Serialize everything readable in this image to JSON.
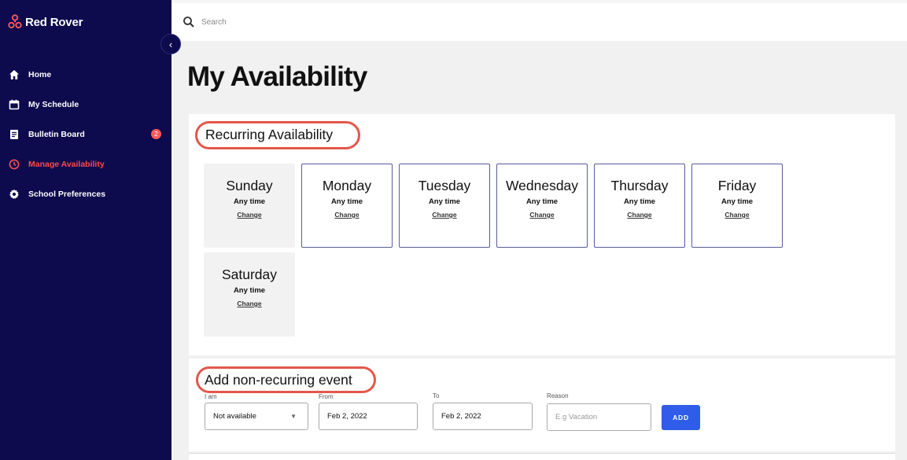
{
  "app": {
    "name": "Red Rover"
  },
  "sidebar": {
    "collapse_icon": "chevron-left-icon",
    "items": [
      {
        "label": "Home",
        "icon": "home-icon",
        "active": false
      },
      {
        "label": "My Schedule",
        "icon": "calendar-icon",
        "active": false
      },
      {
        "label": "Bulletin Board",
        "icon": "document-icon",
        "active": false,
        "badge": "2"
      },
      {
        "label": "Manage Availability",
        "icon": "clock-icon",
        "active": true
      },
      {
        "label": "School Preferences",
        "icon": "gear-icon",
        "active": false
      }
    ]
  },
  "search": {
    "placeholder": "Search"
  },
  "page": {
    "title": "My Availability"
  },
  "recurring": {
    "title": "Recurring Availability",
    "days": [
      {
        "name": "Sunday",
        "time": "Any time",
        "action": "Change",
        "available": false
      },
      {
        "name": "Monday",
        "time": "Any time",
        "action": "Change",
        "available": true
      },
      {
        "name": "Tuesday",
        "time": "Any time",
        "action": "Change",
        "available": true
      },
      {
        "name": "Wednesday",
        "time": "Any time",
        "action": "Change",
        "available": true
      },
      {
        "name": "Thursday",
        "time": "Any time",
        "action": "Change",
        "available": true
      },
      {
        "name": "Friday",
        "time": "Any time",
        "action": "Change",
        "available": true
      },
      {
        "name": "Saturday",
        "time": "Any time",
        "action": "Change",
        "available": false
      }
    ]
  },
  "event": {
    "title": "Add non-recurring event",
    "i_am_label": "I am",
    "i_am_value": "Not available",
    "from_label": "From",
    "from_value": "Feb 2, 2022",
    "to_label": "To",
    "to_value": "Feb 2, 2022",
    "reason_label": "Reason",
    "reason_placeholder": "E.g Vacation",
    "add_label": "ADD"
  },
  "colors": {
    "sidebar_bg": "#0d0a4d",
    "active_nav": "#ff4b4b",
    "annotation_ring": "#e4574a",
    "add_button": "#2f5ce8",
    "day_border": "#5b5a9e"
  }
}
